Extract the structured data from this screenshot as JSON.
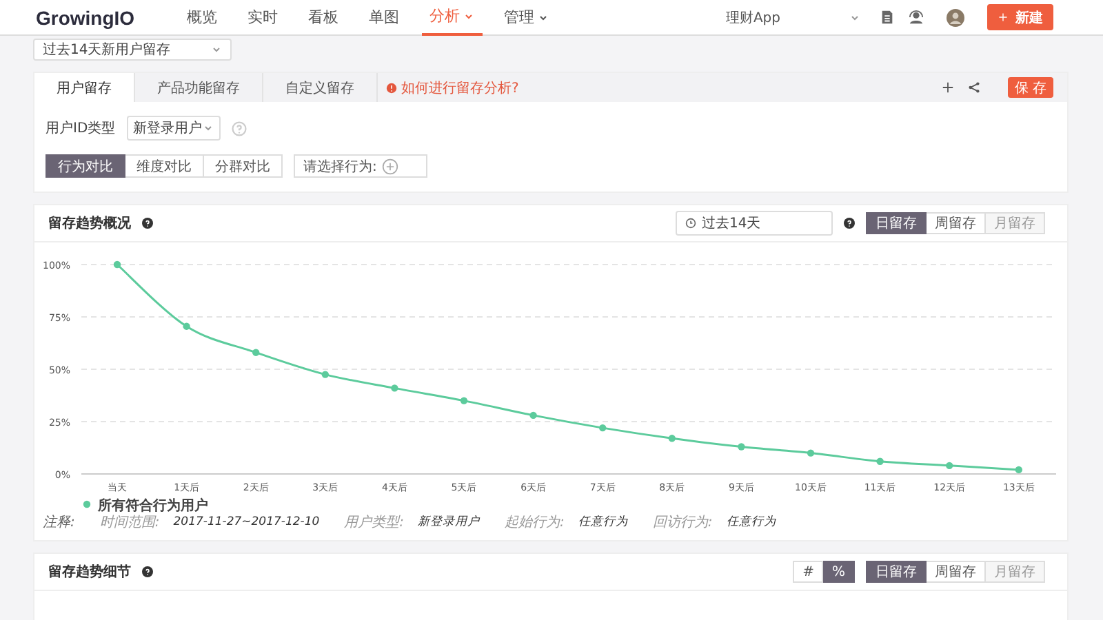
{
  "nav": {
    "logo": "GrowingIO",
    "items": [
      {
        "label": "概览",
        "selected": false,
        "has_menu": false
      },
      {
        "label": "实时",
        "selected": false,
        "has_menu": false
      },
      {
        "label": "看板",
        "selected": false,
        "has_menu": false
      },
      {
        "label": "单图",
        "selected": false,
        "has_menu": false
      },
      {
        "label": "分析",
        "selected": true,
        "has_menu": true
      },
      {
        "label": "管理",
        "selected": false,
        "has_menu": true
      }
    ],
    "app_selector": "理财App",
    "new_button": "新建"
  },
  "report_selector": "过去14天新用户留存",
  "config": {
    "tabs": [
      {
        "label": "用户留存",
        "selected": true
      },
      {
        "label": "产品功能留存",
        "selected": false
      },
      {
        "label": "自定义留存",
        "selected": false
      }
    ],
    "help_link": "如何进行留存分析?",
    "save_button": "保 存",
    "id_type": {
      "label": "用户ID类型",
      "value": "新登录用户"
    },
    "compare_tabs": [
      {
        "label": "行为对比",
        "selected": true
      },
      {
        "label": "维度对比",
        "selected": false
      },
      {
        "label": "分群对比",
        "selected": false
      }
    ],
    "behavior_picker": "请选择行为:"
  },
  "overview": {
    "title": "留存趋势概况",
    "date_range": "过去14天",
    "granularity": [
      {
        "label": "日留存",
        "selected": true,
        "disabled": false
      },
      {
        "label": "周留存",
        "selected": false,
        "disabled": false
      },
      {
        "label": "月留存",
        "selected": false,
        "disabled": true
      }
    ],
    "chart_data": {
      "type": "line",
      "grid": true,
      "categories": [
        "当天",
        "1天后",
        "2天后",
        "3天后",
        "4天后",
        "5天后",
        "6天后",
        "7天后",
        "8天后",
        "9天后",
        "10天后",
        "11天后",
        "12天后",
        "13天后"
      ],
      "ylim": [
        0,
        100
      ],
      "yticks": [
        {
          "value": 0,
          "label": "0%"
        },
        {
          "value": 25,
          "label": "25%"
        },
        {
          "value": 50,
          "label": "50%"
        },
        {
          "value": 75,
          "label": "75%"
        },
        {
          "value": 100,
          "label": "100%"
        }
      ],
      "series": [
        {
          "name": "所有符合行为用户",
          "color": "#5ccb9c",
          "marker": "circle",
          "values": [
            100,
            70.5,
            58,
            47.5,
            41,
            35,
            28,
            22,
            17,
            13,
            10,
            6,
            4,
            2
          ]
        }
      ]
    },
    "notes_label": "注释:",
    "notes": [
      {
        "label": "时间范围:",
        "value": "2017-11-27~2017-12-10"
      },
      {
        "label": "用户类型:",
        "value": "新登录用户"
      },
      {
        "label": "起始行为:",
        "value": "任意行为"
      },
      {
        "label": "回访行为:",
        "value": "任意行为"
      }
    ]
  },
  "detail": {
    "title": "留存趋势细节",
    "value_toggle": [
      {
        "label": "#",
        "selected": false
      },
      {
        "label": "%",
        "selected": true
      }
    ],
    "granularity": [
      {
        "label": "日留存",
        "selected": true,
        "disabled": false
      },
      {
        "label": "周留存",
        "selected": false,
        "disabled": false
      },
      {
        "label": "月留存",
        "selected": false,
        "disabled": true
      }
    ]
  }
}
